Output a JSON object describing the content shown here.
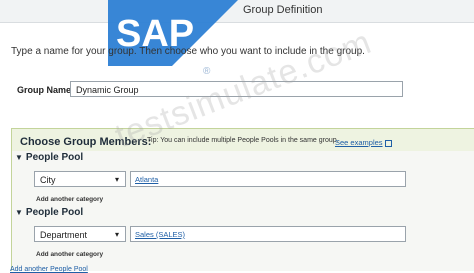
{
  "dialog": {
    "title": "Group Definition",
    "instructions": "Type a name for your group. Then choose who you want to include in the group."
  },
  "brand": {
    "logo_text": "SAP",
    "registered_mark": "®",
    "logo_color": "#2d7fd4"
  },
  "watermark": {
    "text": "testsimulate.com"
  },
  "group_name": {
    "label": "Group Name:",
    "value": "Dynamic Group"
  },
  "members": {
    "title": "Choose Group Members:",
    "tip": "Tip: You can include multiple People Pools in the same group.",
    "see_examples": "See examples",
    "pools": [
      {
        "header": "People Pool",
        "category": "City",
        "value": "Atlanta",
        "add_category": "Add another category"
      },
      {
        "header": "People Pool",
        "category": "Department",
        "value": "Sales (SALES)",
        "add_category": "Add another category"
      }
    ],
    "add_pool": "Add another People Pool"
  }
}
